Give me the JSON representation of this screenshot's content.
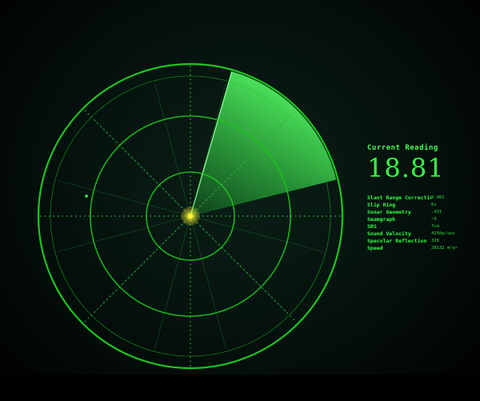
{
  "current_reading": {
    "label": "Current Reading",
    "value": "18.81"
  },
  "parameters": [
    {
      "key": "Slant Range Correction",
      "value": "8.001"
    },
    {
      "key": "Slip Ring",
      "value": "6x"
    },
    {
      "key": "Sonar Geometry",
      "value": ".431"
    },
    {
      "key": "Seamgraph",
      "value": "~3"
    },
    {
      "key": "SRS",
      "value": "7cm"
    },
    {
      "key": "Sound Velocity",
      "value": "4250p/sec"
    },
    {
      "key": "Specular Reflection",
      "value": "328"
    },
    {
      "key": "Speed",
      "value": "28132 m/yr"
    }
  ],
  "colors": {
    "accent": "#33ff44",
    "ring": "#1fc41f",
    "grid": "#1a8a2a",
    "center": "#ffee33",
    "background": "#04100b"
  }
}
